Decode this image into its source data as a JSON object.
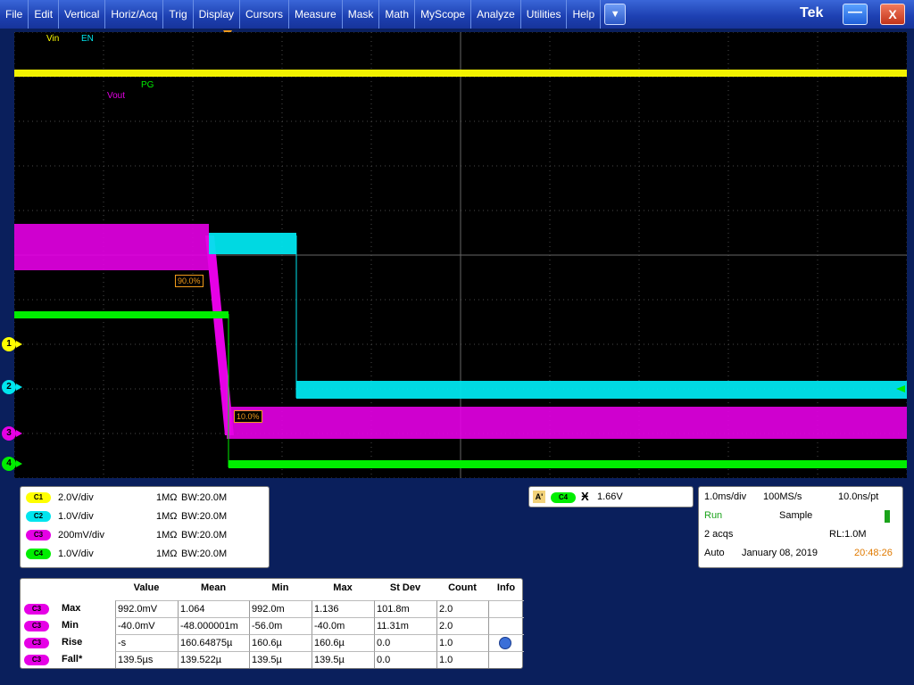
{
  "menu": {
    "items": [
      "File",
      "Edit",
      "Vertical",
      "Horiz/Acq",
      "Trig",
      "Display",
      "Cursors",
      "Measure",
      "Mask",
      "Math",
      "MyScope",
      "Analyze",
      "Utilities",
      "Help"
    ],
    "dropdown_glyph": "▼",
    "brand": "Tek",
    "minimize_glyph": "—",
    "close_glyph": "X"
  },
  "colors": {
    "ch1": "#ffff00",
    "ch2": "#00e5ee",
    "ch3": "#e600e6",
    "ch4": "#00ee00",
    "grid": "#4a4a4a",
    "trigger": "#f29b1a"
  },
  "waveform_labels": {
    "vin": "Vin",
    "en": "EN",
    "pg": "PG",
    "vout": "Vout"
  },
  "ref_labels": {
    "upper": "90.0%",
    "lower": "10.0%"
  },
  "channel_markers": [
    "1",
    "2",
    "3",
    "4"
  ],
  "vertical": [
    {
      "badge": "C1",
      "vdiv": "2.0V/div",
      "imp": "1MΩ",
      "bw": "W:20.0M"
    },
    {
      "badge": "C2",
      "vdiv": "1.0V/div",
      "imp": "1MΩ",
      "bw": "W:20.0M"
    },
    {
      "badge": "C3",
      "vdiv": "200mV/div",
      "imp": "1MΩ",
      "bw": "W:20.0M"
    },
    {
      "badge": "C4",
      "vdiv": "1.0V/div",
      "imp": "1MΩ",
      "bw": "W:20.0M"
    }
  ],
  "bw_prefix": "B",
  "trigger": {
    "mode_letter": "A'",
    "source": "C4",
    "slope_glyph": "Ӿ",
    "level": "1.66V"
  },
  "acquisition": {
    "timebase": "1.0ms/div",
    "sample_rate": "100MS/s",
    "resolution": "10.0ns/pt",
    "state": "Run",
    "mode": "Sample",
    "acqs": "2 acqs",
    "record_length": "RL:1.0M",
    "trigger_mode": "Auto",
    "date": "January 08, 2019",
    "time": "20:48:26"
  },
  "measurements": {
    "headers": [
      "Value",
      "Mean",
      "Min",
      "Max",
      "St Dev",
      "Count",
      "Info"
    ],
    "rows": [
      {
        "badge": "C3",
        "label": "Max",
        "cells": [
          "992.0mV",
          "1.064",
          "992.0m",
          "1.136",
          "101.8m",
          "2.0",
          ""
        ]
      },
      {
        "badge": "C3",
        "label": "Min",
        "cells": [
          "-40.0mV",
          "-48.000001m",
          "-56.0m",
          "-40.0m",
          "11.31m",
          "2.0",
          ""
        ]
      },
      {
        "badge": "C3",
        "label": "Rise",
        "cells": [
          "-s",
          "160.64875µ",
          "160.6µ",
          "160.6µ",
          "0.0",
          "1.0",
          ""
        ]
      },
      {
        "badge": "C3",
        "label": "Fall*",
        "cells": [
          "139.5µs",
          "139.522µ",
          "139.5µ",
          "139.5µ",
          "0.0",
          "1.0",
          ""
        ]
      }
    ]
  }
}
